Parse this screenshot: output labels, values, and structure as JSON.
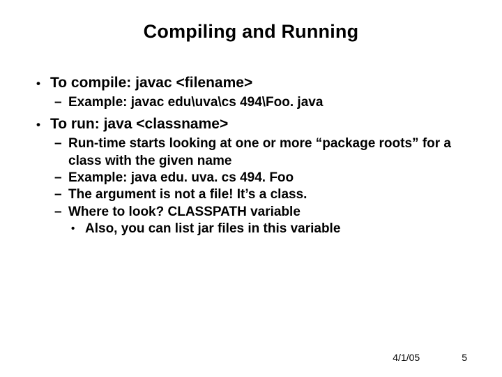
{
  "title": "Compiling and Running",
  "items": [
    {
      "text": "To compile:  javac <filename>",
      "sub": [
        {
          "text": "Example:  javac edu\\uva\\cs 494\\Foo. java"
        }
      ]
    },
    {
      "text": "To run:  java <classname>",
      "sub": [
        {
          "text": "Run-time starts looking at one or more “package roots” for a class with the given name"
        },
        {
          "text": "Example:  java edu. uva. cs 494. Foo"
        },
        {
          "text": "The argument is not a file!  It’s a class."
        },
        {
          "text": "Where to look?  CLASSPATH variable",
          "sub": [
            {
              "text": "Also, you can list jar files in this variable"
            }
          ]
        }
      ]
    }
  ],
  "footer": {
    "date": "4/1/05",
    "page": "5"
  }
}
